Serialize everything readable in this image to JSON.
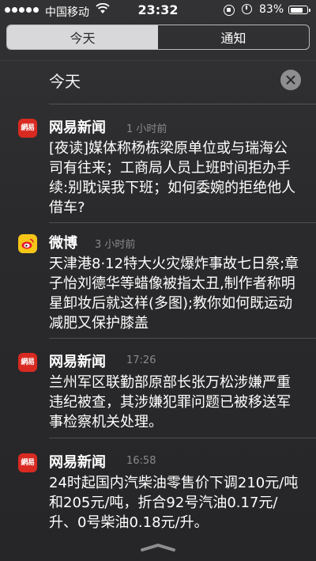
{
  "status_bar": {
    "carrier": "中国移动",
    "time": "23:32",
    "battery_percent": "83%",
    "battery_level": 0.83,
    "signal_bars": 5
  },
  "segmented": {
    "tabs": [
      {
        "label": "今天",
        "selected": true
      },
      {
        "label": "通知",
        "selected": false
      }
    ]
  },
  "section": {
    "title": "今天",
    "clear_icon": "close-icon"
  },
  "notifications": [
    {
      "app": "网易新闻",
      "icon": "netease-news-icon",
      "icon_text": "網易",
      "time": "1 小时前",
      "body": "[夜读]媒体称杨栋梁原单位或与瑞海公司有往来；工商局人员上班时间拒办手续:别耽误我下班；如何委婉的拒绝他人借车?"
    },
    {
      "app": "微博",
      "icon": "weibo-icon",
      "time": "3 小时前",
      "body": "天津港8·12特大火灾爆炸事故七日祭;章子怡刘德华等蜡像被指太丑,制作者称明星卸妆后就这样(多图);教你如何既运动减肥又保护膝盖"
    },
    {
      "app": "网易新闻",
      "icon": "netease-news-icon",
      "icon_text": "網易",
      "time": "17:26",
      "body": "兰州军区联勤部原部长张万松涉嫌严重违纪被查，其涉嫌犯罪问题已被移送军事检察机关处理。"
    },
    {
      "app": "网易新闻",
      "icon": "netease-news-icon",
      "icon_text": "網易",
      "time": "16:58",
      "body": "24时起国内汽柴油零售价下调210元/吨和205元/吨，折合92号汽油0.17元/升、0号柴油0.18元/升。"
    }
  ],
  "colors": {
    "netease_red": "#d82a21",
    "weibo_yellow": "#f5c518",
    "background": "#2b2b2d"
  }
}
